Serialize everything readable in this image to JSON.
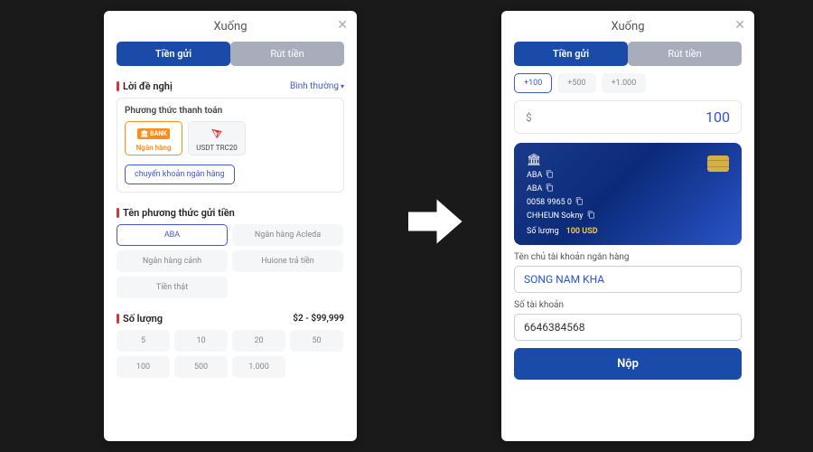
{
  "left": {
    "title": "Xuống",
    "tabs": {
      "deposit": "Tiền gửi",
      "withdraw": "Rút tiền"
    },
    "offer": {
      "title": "Lời đề nghị",
      "priority": "Bình thường"
    },
    "payment": {
      "subtitle": "Phương thức thanh toán",
      "bank_label": "Ngân hàng",
      "bank_badge": "BANK",
      "usdt_label": "USDT TRC20",
      "transfer": "chuyển khoản ngân hàng"
    },
    "method": {
      "title": "Tên phương thức gửi tiền",
      "options": [
        "ABA",
        "Ngân hàng Acleda",
        "Ngân hàng cảnh",
        "Huione trả tiền",
        "Tiền thật"
      ]
    },
    "qty": {
      "title": "Số lượng",
      "range": "$2 - $99,999",
      "amounts": [
        "5",
        "10",
        "20",
        "50",
        "100",
        "500",
        "1.000"
      ]
    }
  },
  "right": {
    "title": "Xuống",
    "tabs": {
      "deposit": "Tiền gửi",
      "withdraw": "Rút tiền"
    },
    "quick": [
      "+100",
      "+500",
      "+1.000"
    ],
    "currency": "$",
    "amount": "100",
    "card": {
      "bank": "ABA",
      "bank2": "ABA",
      "number": "0058 9965 0",
      "holder": "CHHEUN Sokny",
      "qty_label": "Số lượng",
      "qty_value": "100 USD"
    },
    "holder": {
      "label": "Tên chủ tài khoản ngân hàng",
      "value": "SONG NAM KHA"
    },
    "account": {
      "label": "Số tài khoản",
      "value": "6646384568"
    },
    "submit": "Nộp"
  }
}
